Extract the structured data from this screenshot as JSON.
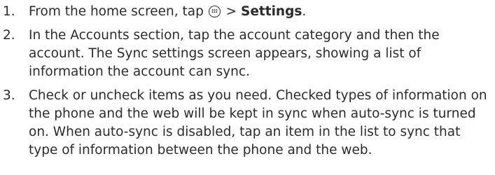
{
  "steps": [
    {
      "number": "1.",
      "pre": "From the home screen, tap ",
      "icon": "apps-icon",
      "mid": " > ",
      "bold": "Settings",
      "post": "."
    },
    {
      "number": "2.",
      "text": "In the Accounts section, tap the account category and then the account. The Sync settings screen appears, showing a list of information the account can sync."
    },
    {
      "number": "3.",
      "text": "Check or uncheck items as you need. Checked types of information on the phone and the web will be kept in sync when auto-sync is turned on.  When auto-sync is disabled, tap an item in the list to sync that type of information between the phone and the web."
    }
  ]
}
